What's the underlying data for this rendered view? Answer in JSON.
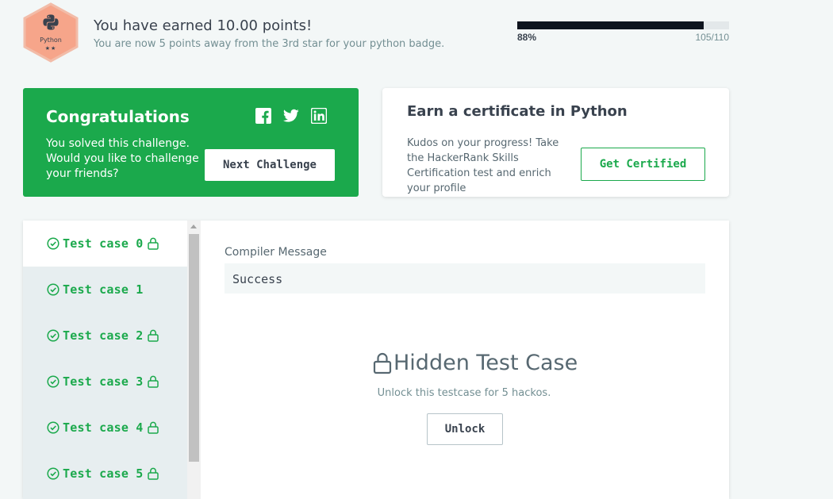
{
  "badge": {
    "name": "Python",
    "stars": "★★",
    "icon": "python-logo-icon",
    "color": "#f7a78d"
  },
  "banner": {
    "title": "You have earned 10.00 points!",
    "subtitle": "You are now 5 points away from the 3rd star for your python badge.",
    "progress_percent": "88%",
    "progress_fraction": 0.88,
    "progress_count": "105/110"
  },
  "congrats": {
    "title": "Congratulations",
    "message": "You solved this challenge. Would you like to challenge your friends?",
    "next_button": "Next Challenge",
    "social_icons": [
      "facebook-icon",
      "twitter-icon",
      "linkedin-icon"
    ],
    "background": "#1ba94c"
  },
  "certificate": {
    "title": "Earn a certificate in Python",
    "message": "Kudos on your progress! Take the HackerRank Skills Certification test and enrich your profile",
    "button": "Get Certified"
  },
  "test_cases": [
    {
      "label": "Test case 0",
      "locked": true,
      "active": true
    },
    {
      "label": "Test case 1",
      "locked": false,
      "active": false
    },
    {
      "label": "Test case 2",
      "locked": true,
      "active": false
    },
    {
      "label": "Test case 3",
      "locked": true,
      "active": false
    },
    {
      "label": "Test case 4",
      "locked": true,
      "active": false
    },
    {
      "label": "Test case 5",
      "locked": true,
      "active": false
    }
  ],
  "result": {
    "compiler_label": "Compiler Message",
    "compiler_message": "Success",
    "hidden_title": "Hidden Test Case",
    "hidden_subtitle": "Unlock this testcase for 5 hackos.",
    "unlock_button": "Unlock"
  },
  "colors": {
    "accent_green": "#1ba94c",
    "text_dark": "#39424e",
    "progress_fill": "#0e141e"
  }
}
